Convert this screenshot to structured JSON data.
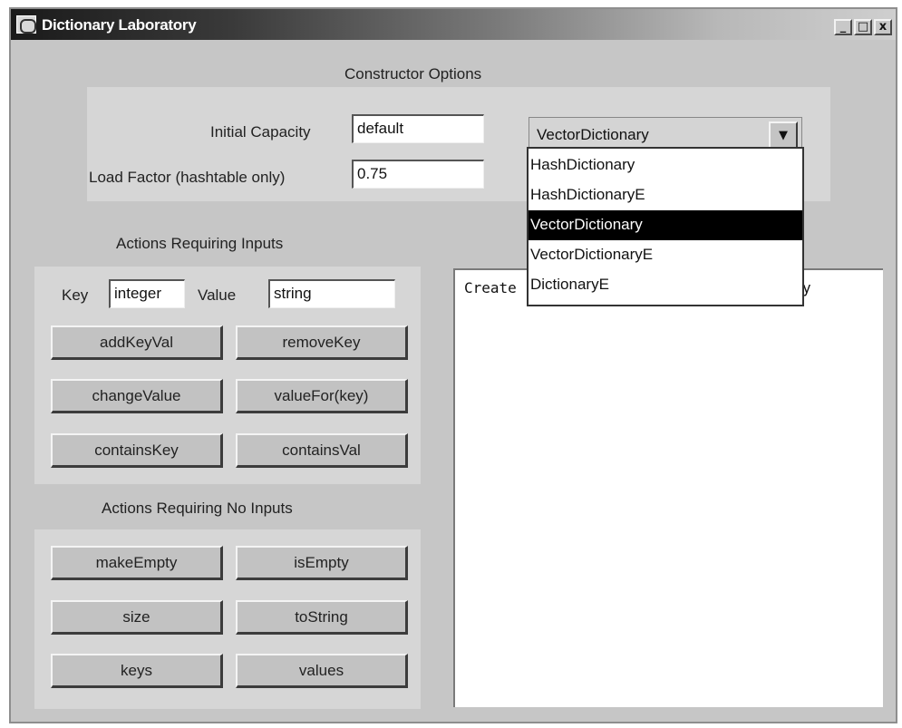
{
  "window": {
    "title": "Dictionary Laboratory",
    "controls": [
      "_",
      "□",
      "x"
    ]
  },
  "constructor": {
    "heading": "Constructor Options",
    "initial_capacity_label": "Initial Capacity",
    "initial_capacity_value": "default",
    "load_factor_label": "Load Factor (hashtable only)",
    "load_factor_value": "0.75",
    "type_selected": "VectorDictionary",
    "type_options": [
      "HashDictionary",
      "HashDictionaryE",
      "VectorDictionary",
      "VectorDictionaryE",
      "DictionaryE"
    ]
  },
  "inputs_section": {
    "heading": "Actions Requiring Inputs",
    "key_label": "Key",
    "key_value": "integer",
    "value_label": "Value",
    "value_value": "string",
    "buttons": [
      "addKeyVal",
      "removeKey",
      "changeValue",
      "valueFor(key)",
      "containsKey",
      "containsVal"
    ]
  },
  "no_inputs_section": {
    "heading": "Actions Requiring No Inputs",
    "buttons": [
      "makeEmpty",
      "isEmpty",
      "size",
      "toString",
      "keys",
      "values"
    ]
  },
  "output": {
    "text_start": "Create",
    "text_end": "y"
  }
}
